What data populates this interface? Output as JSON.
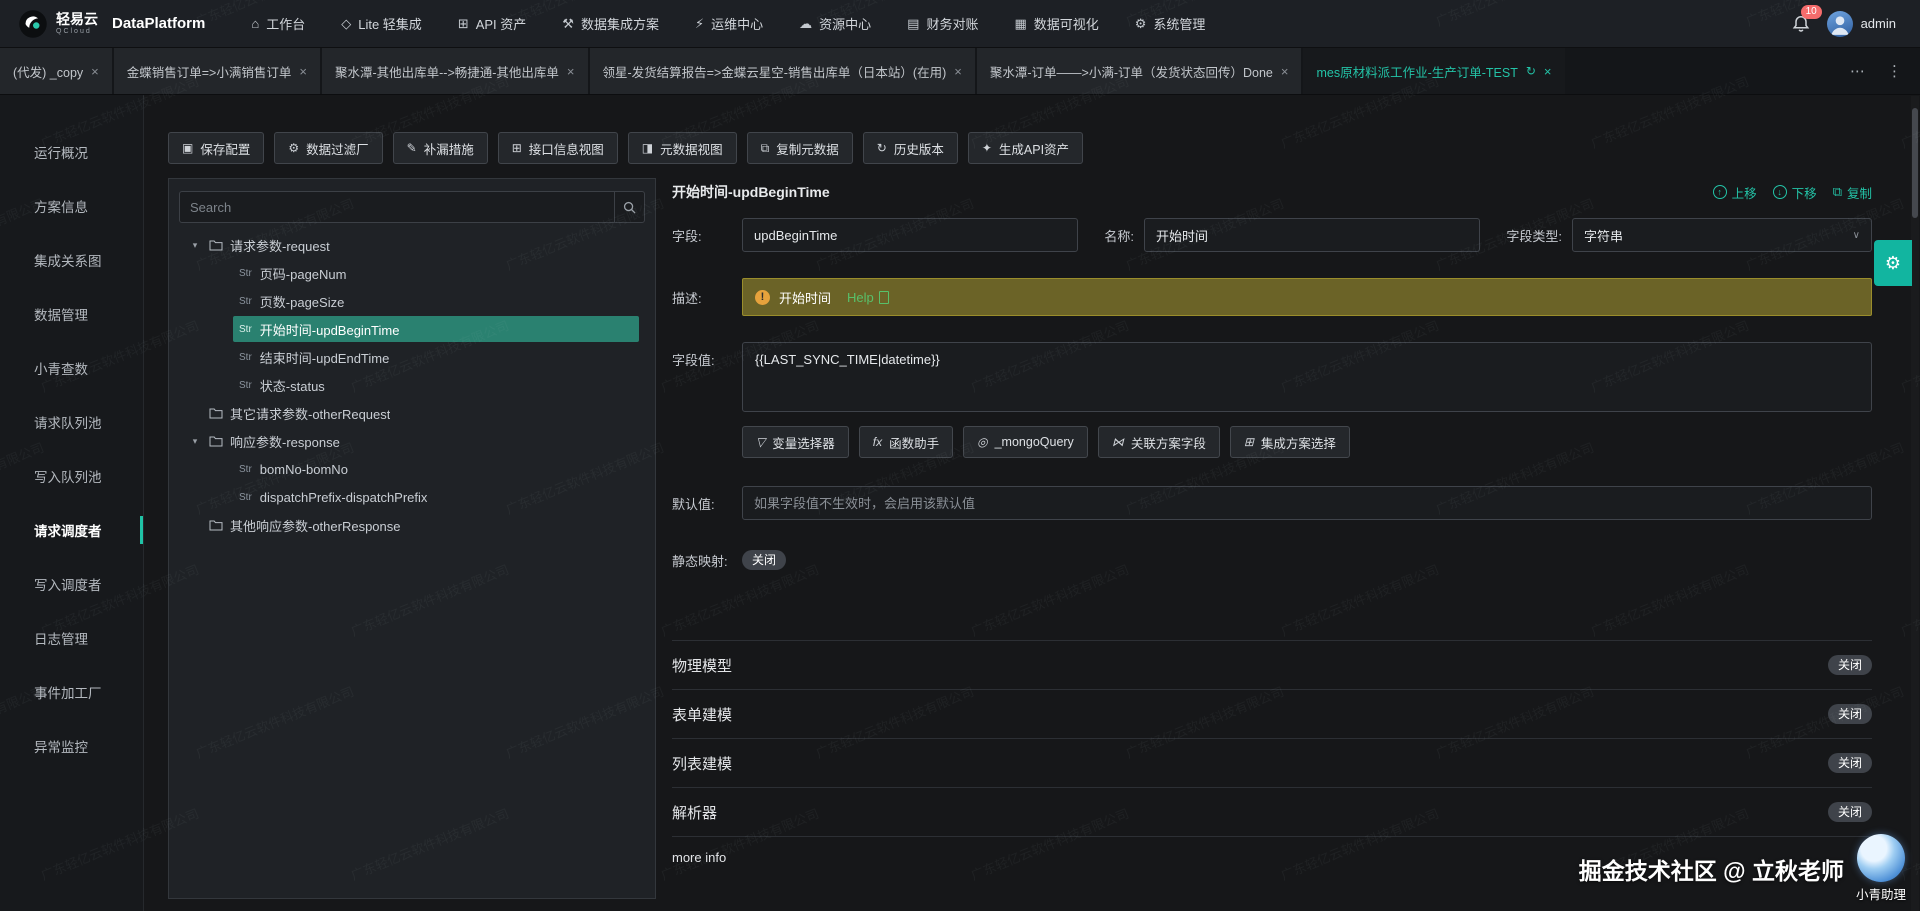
{
  "watermark": {
    "text": "广东轻亿云软件科技有限公司"
  },
  "icons": {
    "chevron": "∨",
    "warning": "!"
  },
  "navbar": {
    "logo": {
      "brand": "轻易云",
      "sub": "QCloud",
      "product": "DataPlatform"
    },
    "items": [
      {
        "label": "工作台",
        "icon": "⌂",
        "icon_name": "workbench-icon"
      },
      {
        "label": "Lite 轻集成",
        "icon": "◇",
        "icon_name": "lite-integration-icon"
      },
      {
        "label": "API 资产",
        "icon": "⊞",
        "icon_name": "api-assets-icon"
      },
      {
        "label": "数据集成方案",
        "icon": "⚒",
        "icon_name": "data-integration-icon"
      },
      {
        "label": "运维中心",
        "icon": "⚡",
        "icon_name": "ops-center-icon"
      },
      {
        "label": "资源中心",
        "icon": "☁",
        "icon_name": "resource-center-icon"
      },
      {
        "label": "财务对账",
        "icon": "▤",
        "icon_name": "finance-icon"
      },
      {
        "label": "数据可视化",
        "icon": "▦",
        "icon_name": "visualization-icon"
      },
      {
        "label": "系统管理",
        "icon": "⚙",
        "icon_name": "system-icon"
      }
    ],
    "notification_count": "10",
    "username": "admin"
  },
  "tabs": {
    "items": [
      {
        "label": "(代发) _copy",
        "close": "×"
      },
      {
        "label": "金蝶销售订单=>小满销售订单",
        "close": "×"
      },
      {
        "label": "聚水潭-其他出库单-->畅捷通-其他出库单",
        "close": "×"
      },
      {
        "label": "领星-发货结算报告=>金蝶云星空-销售出库单（日本站）(在用)",
        "close": "×"
      },
      {
        "label": "聚水潭-订单——>小满-订单（发货状态回传）Done",
        "close": "×"
      },
      {
        "label": "mes原材料派工作业-生产订单-TEST",
        "close": "×",
        "refresh": "↻",
        "active": true
      }
    ],
    "more_icon": "⋯",
    "menu_icon": "⋮"
  },
  "sidebar": {
    "items": [
      {
        "label": "运行概况"
      },
      {
        "label": "方案信息"
      },
      {
        "label": "集成关系图"
      },
      {
        "label": "数据管理"
      },
      {
        "label": "小青查数"
      },
      {
        "label": "请求队列池"
      },
      {
        "label": "写入队列池"
      },
      {
        "label": "请求调度者",
        "active": true
      },
      {
        "label": "写入调度者"
      },
      {
        "label": "日志管理"
      },
      {
        "label": "事件加工厂"
      },
      {
        "label": "异常监控"
      }
    ]
  },
  "toolbar": {
    "buttons": [
      {
        "icon": "▣",
        "label": "保存配置",
        "icon_name": "save-icon"
      },
      {
        "icon": "⚙",
        "label": "数据过滤厂",
        "icon_name": "filter-icon"
      },
      {
        "icon": "✎",
        "label": "补漏措施",
        "icon_name": "patch-icon"
      },
      {
        "icon": "⊞",
        "label": "接口信息视图",
        "icon_name": "api-info-view-icon"
      },
      {
        "icon": "◨",
        "label": "元数据视图",
        "icon_name": "metadata-view-icon"
      },
      {
        "icon": "⧉",
        "label": "复制元数据",
        "icon_name": "copy-metadata-icon"
      },
      {
        "icon": "↻",
        "label": "历史版本",
        "icon_name": "history-icon"
      },
      {
        "icon": "✦",
        "label": "生成API资产",
        "icon_name": "generate-api-icon"
      }
    ],
    "intelligent": "intelligent"
  },
  "tree": {
    "search_placeholder": "Search",
    "items": [
      {
        "caret": "▾",
        "folder": true,
        "label": "请求参数-request"
      },
      {
        "str": "Str",
        "label": "页码-pageNum"
      },
      {
        "str": "Str",
        "label": "页数-pageSize"
      },
      {
        "str": "Str",
        "label": "开始时间-updBeginTime",
        "selected": true
      },
      {
        "str": "Str",
        "label": "结束时间-updEndTime"
      },
      {
        "str": "Str",
        "label": "状态-status"
      },
      {
        "folder": true,
        "label": "其它请求参数-otherRequest"
      },
      {
        "caret": "▾",
        "folder": true,
        "label": "响应参数-response"
      },
      {
        "str": "Str",
        "label": "bomNo-bomNo"
      },
      {
        "str": "Str",
        "label": "dispatchPrefix-dispatchPrefix"
      },
      {
        "folder": true,
        "label": "其他响应参数-otherResponse"
      }
    ]
  },
  "detail": {
    "title": "开始时间-updBeginTime",
    "actions": [
      {
        "icon": "↑",
        "label": "上移",
        "icon_name": "move-up-icon"
      },
      {
        "icon": "↓",
        "label": "下移",
        "icon_name": "move-down-icon"
      },
      {
        "icon": "⧉",
        "label": "复制",
        "icon_name": "copy-icon"
      }
    ],
    "fields": {
      "field_label": "字段:",
      "field_value": "updBeginTime",
      "name_label": "名称:",
      "name_value": "开始时间",
      "type_label": "字段类型:",
      "type_value": "字符串",
      "desc_label": "描述:",
      "desc_text": "开始时间",
      "desc_help": "Help",
      "value_label": "字段值:",
      "value_text": "{{LAST_SYNC_TIME|datetime}}",
      "default_label": "默认值:",
      "default_placeholder": "如果字段值不生效时，会启用该默认值",
      "static_map_label": "静态映射:",
      "static_map_state": "关闭"
    },
    "helper_buttons": [
      {
        "icon": "▽",
        "label": "变量选择器",
        "icon_name": "funnel-icon"
      },
      {
        "icon": "fx",
        "label": "函数助手",
        "icon_name": "fx-icon"
      },
      {
        "icon": "◎",
        "label": "_mongoQuery",
        "icon_name": "mongo-query-icon"
      },
      {
        "icon": "⋈",
        "label": "关联方案字段",
        "icon_name": "link-field-icon"
      },
      {
        "icon": "⊞",
        "label": "集成方案选择",
        "icon_name": "integration-select-icon"
      }
    ],
    "sections": [
      {
        "label": "物理模型",
        "state": "关闭"
      },
      {
        "label": "表单建模",
        "state": "关闭"
      },
      {
        "label": "列表建模",
        "state": "关闭"
      },
      {
        "label": "解析器",
        "state": "关闭"
      }
    ],
    "more_info": "more info"
  },
  "credit": {
    "community": "掘金技术社区 @ 立秋老师",
    "assistant": "小青助理"
  }
}
